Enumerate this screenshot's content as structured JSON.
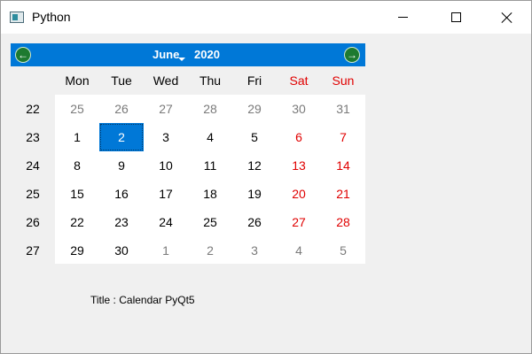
{
  "window": {
    "title": "Python"
  },
  "calendar": {
    "month": "June",
    "year": "2020",
    "weekday_headers": [
      {
        "label": "Mon",
        "weekend": false
      },
      {
        "label": "Tue",
        "weekend": false
      },
      {
        "label": "Wed",
        "weekend": false
      },
      {
        "label": "Thu",
        "weekend": false
      },
      {
        "label": "Fri",
        "weekend": false
      },
      {
        "label": "Sat",
        "weekend": true
      },
      {
        "label": "Sun",
        "weekend": true
      }
    ],
    "week_numbers": [
      "22",
      "23",
      "24",
      "25",
      "26",
      "27"
    ],
    "weeks": [
      [
        {
          "d": "25",
          "other": true
        },
        {
          "d": "26",
          "other": true
        },
        {
          "d": "27",
          "other": true
        },
        {
          "d": "28",
          "other": true
        },
        {
          "d": "29",
          "other": true
        },
        {
          "d": "30",
          "other": true
        },
        {
          "d": "31",
          "other": true
        }
      ],
      [
        {
          "d": "1"
        },
        {
          "d": "2",
          "selected": true
        },
        {
          "d": "3"
        },
        {
          "d": "4"
        },
        {
          "d": "5"
        },
        {
          "d": "6",
          "weekend": true
        },
        {
          "d": "7",
          "weekend": true
        }
      ],
      [
        {
          "d": "8"
        },
        {
          "d": "9"
        },
        {
          "d": "10"
        },
        {
          "d": "11"
        },
        {
          "d": "12"
        },
        {
          "d": "13",
          "weekend": true
        },
        {
          "d": "14",
          "weekend": true
        }
      ],
      [
        {
          "d": "15"
        },
        {
          "d": "16"
        },
        {
          "d": "17"
        },
        {
          "d": "18"
        },
        {
          "d": "19"
        },
        {
          "d": "20",
          "weekend": true
        },
        {
          "d": "21",
          "weekend": true
        }
      ],
      [
        {
          "d": "22"
        },
        {
          "d": "23"
        },
        {
          "d": "24"
        },
        {
          "d": "25"
        },
        {
          "d": "26"
        },
        {
          "d": "27",
          "weekend": true
        },
        {
          "d": "28",
          "weekend": true
        }
      ],
      [
        {
          "d": "29"
        },
        {
          "d": "30"
        },
        {
          "d": "1",
          "other": true
        },
        {
          "d": "2",
          "other": true
        },
        {
          "d": "3",
          "other": true
        },
        {
          "d": "4",
          "other": true
        },
        {
          "d": "5",
          "other": true
        }
      ]
    ]
  },
  "label": {
    "text": "Title : Calendar PyQt5"
  },
  "colors": {
    "accent": "#0078d7",
    "weekend": "#e00000",
    "other_month": "#7a7a7a"
  },
  "icons": {
    "prev": "arrow-left-icon",
    "next": "arrow-right-icon"
  }
}
